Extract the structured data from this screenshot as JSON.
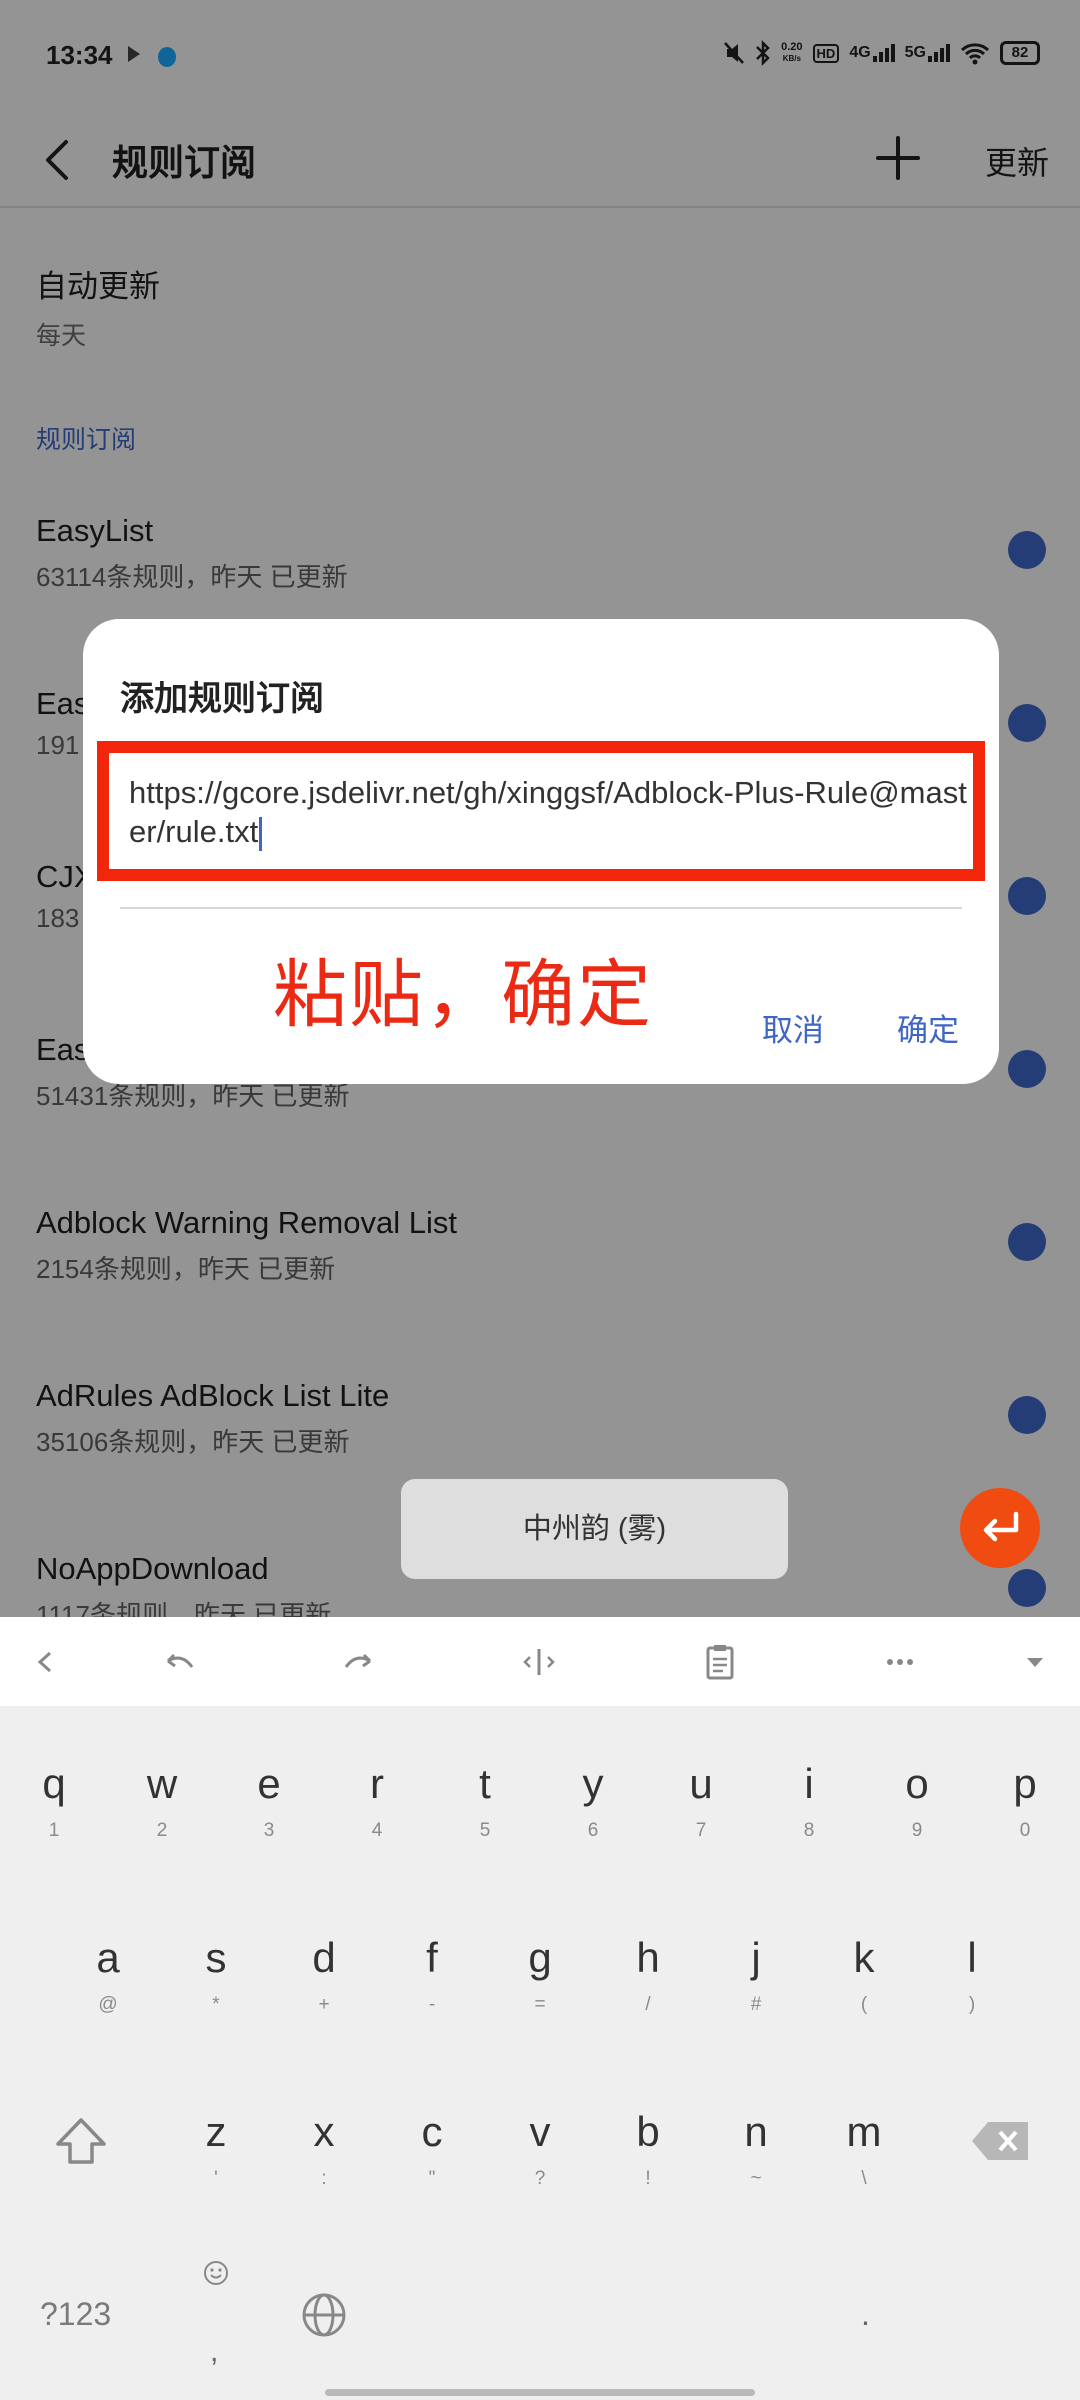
{
  "status_bar": {
    "time": "13:34",
    "net_speed_value": "0.20",
    "net_speed_unit": "KB/s",
    "hd_label": "HD",
    "network_1": "4G",
    "network_2": "5G",
    "battery": "82"
  },
  "app_bar": {
    "title": "规则订阅",
    "update_label": "更新"
  },
  "auto_update": {
    "title": "自动更新",
    "value": "每天"
  },
  "section_header": "规则订阅",
  "subscriptions": [
    {
      "name": "EasyList",
      "info": "63114条规则，昨天 已更新"
    },
    {
      "name": "Eas",
      "info": "191"
    },
    {
      "name": "CJX",
      "info": "183"
    },
    {
      "name": "Eas",
      "info": "51431条规则，昨天 已更新"
    },
    {
      "name": "Adblock Warning Removal List",
      "info": "2154条规则，昨天 已更新"
    },
    {
      "name": "AdRules AdBlock List Lite",
      "info": "35106条规则，昨天 已更新"
    },
    {
      "name": "NoAppDownload",
      "info": "1117条规则，昨天 已更新"
    }
  ],
  "dialog": {
    "title": "添加规则订阅",
    "input_value": "https://gcore.jsdelivr.net/gh/xinggsf/Adblock-Plus-Rule@master/rule.txt",
    "annotation": "粘贴，确定",
    "cancel_label": "取消",
    "confirm_label": "确定"
  },
  "keyboard": {
    "row1": [
      {
        "key": "q",
        "sub": "1"
      },
      {
        "key": "w",
        "sub": "2"
      },
      {
        "key": "e",
        "sub": "3"
      },
      {
        "key": "r",
        "sub": "4"
      },
      {
        "key": "t",
        "sub": "5"
      },
      {
        "key": "y",
        "sub": "6"
      },
      {
        "key": "u",
        "sub": "7"
      },
      {
        "key": "i",
        "sub": "8"
      },
      {
        "key": "o",
        "sub": "9"
      },
      {
        "key": "p",
        "sub": "0"
      }
    ],
    "row2": [
      {
        "key": "a",
        "sub": "@"
      },
      {
        "key": "s",
        "sub": "*"
      },
      {
        "key": "d",
        "sub": "+"
      },
      {
        "key": "f",
        "sub": "-"
      },
      {
        "key": "g",
        "sub": "="
      },
      {
        "key": "h",
        "sub": "/"
      },
      {
        "key": "j",
        "sub": "#"
      },
      {
        "key": "k",
        "sub": "("
      },
      {
        "key": "l",
        "sub": ")"
      }
    ],
    "row3": [
      {
        "key": "z",
        "sub": "'"
      },
      {
        "key": "x",
        "sub": ":"
      },
      {
        "key": "c",
        "sub": "\""
      },
      {
        "key": "v",
        "sub": "?"
      },
      {
        "key": "b",
        "sub": "!"
      },
      {
        "key": "n",
        "sub": "~"
      },
      {
        "key": "m",
        "sub": "\\"
      }
    ],
    "symbols_label": "?123",
    "comma_label": ",",
    "space_label": "中州韵 (雾)",
    "period_label": "."
  },
  "colors": {
    "accent": "#3f66c5",
    "annotation_red": "#ea2a14",
    "enter_orange": "#f04b10"
  }
}
